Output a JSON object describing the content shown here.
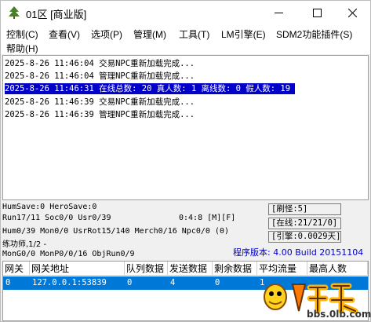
{
  "window": {
    "title": "01区 [商业版]"
  },
  "menu": {
    "items": [
      "控制(C)",
      "查看(V)",
      "选项(P)",
      "管理(M)",
      "工具(T)",
      "LM引擎(E)",
      "SDM2功能插件(S)",
      "帮助(H)"
    ]
  },
  "log": {
    "lines": [
      "2025-8-26 11:46:04 交易NPC重新加载完成...",
      "2025-8-26 11:46:04 管理NPC重新加载完成...",
      "2025-8-26 11:46:31 在线总数: 20 真人数: 1 离线数: 0 假人数: 19",
      "2025-8-26 11:46:39 交易NPC重新加载完成...",
      "2025-8-26 11:46:39 管理NPC重新加载完成..."
    ],
    "selected_index": 2
  },
  "status": {
    "save": "HumSave:0 HeroSave:0",
    "run": "Run17/11 Soc0/0 Usr0/39",
    "time": "0:4:8 [M][F]",
    "hum": "Hum0/39 Mon0/0 UsrRot15/140 Merch0/16 Npc0/0 (0)",
    "lianji": "练功师,1/2 -",
    "mongo": "MonG0/0 MonP0/0/16 ObjRun0/9",
    "refresh": "[刷怪:5]",
    "online": "[在线:21/21/0]",
    "engine": "[引擎:0.0029天]",
    "version": "程序版本: 4.00 Build 20151104"
  },
  "gateway_table": {
    "headers": [
      "网关",
      "网关地址",
      "队列数据",
      "发送数据",
      "剩余数据",
      "平均流量",
      "最高人数"
    ],
    "rows": [
      [
        "0",
        "127.0.0.1:53839",
        "0",
        "4",
        "0",
        "1",
        ""
      ]
    ]
  },
  "watermark": {
    "text": "bbs.0lb.com"
  },
  "colors": {
    "log_selection": "#0000c8",
    "row_selection": "#0078d7",
    "version_text": "#0000c8"
  }
}
